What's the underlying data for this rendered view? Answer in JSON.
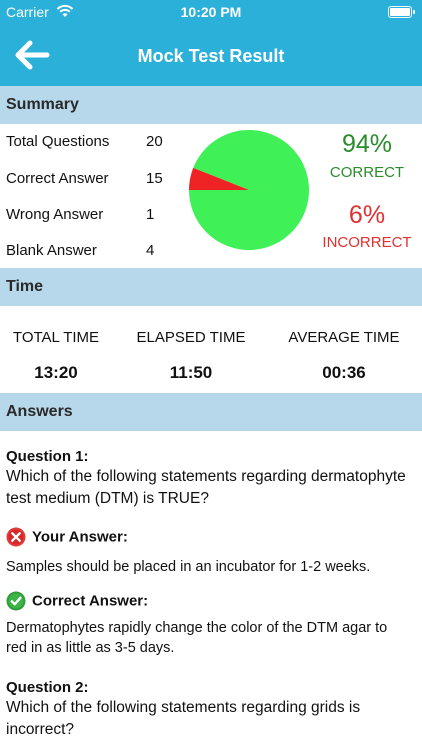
{
  "status_bar": {
    "carrier": "Carrier",
    "time": "10:20 PM"
  },
  "nav": {
    "title": "Mock Test Result"
  },
  "colors": {
    "primary": "#2bb0da",
    "section": "#b7d7eb",
    "correct": "#2a8c2a",
    "incorrect": "#e03030",
    "pie_correct": "#3ff056",
    "pie_incorrect": "#ee2424"
  },
  "summary": {
    "header": "Summary",
    "rows": [
      {
        "label": "Total Questions",
        "value": "20"
      },
      {
        "label": "Correct Answer",
        "value": "15"
      },
      {
        "label": "Wrong Answer",
        "value": "1"
      },
      {
        "label": "Blank Answer",
        "value": "4"
      }
    ],
    "correct_pct": "94%",
    "correct_label": "CORRECT",
    "incorrect_pct": "6%",
    "incorrect_label": "INCORRECT",
    "pie_fractions": {
      "correct": 0.94,
      "incorrect": 0.06
    }
  },
  "time": {
    "header": "Time",
    "columns": [
      {
        "label": "TOTAL TIME",
        "value": "13:20"
      },
      {
        "label": "ELAPSED TIME",
        "value": "11:50"
      },
      {
        "label": "AVERAGE TIME",
        "value": "00:36"
      }
    ]
  },
  "answers": {
    "header": "Answers",
    "questions": [
      {
        "title": "Question 1:",
        "text": "Which of the following statements regarding dermatophyte test medium (DTM) is TRUE?",
        "your_answer_label": "Your Answer:",
        "your_answer": "Samples should be placed in an incubator for 1-2 weeks.",
        "correct_answer_label": "Correct Answer:",
        "correct_answer": "Dermatophytes rapidly change the color of the DTM agar to red in as little as 3-5 days."
      },
      {
        "title": "Question 2:",
        "text": "Which of the following statements regarding grids is incorrect?"
      }
    ]
  },
  "icons": {
    "back": "arrow-left-icon",
    "wrong": "x-circle-icon",
    "right": "check-circle-icon"
  }
}
